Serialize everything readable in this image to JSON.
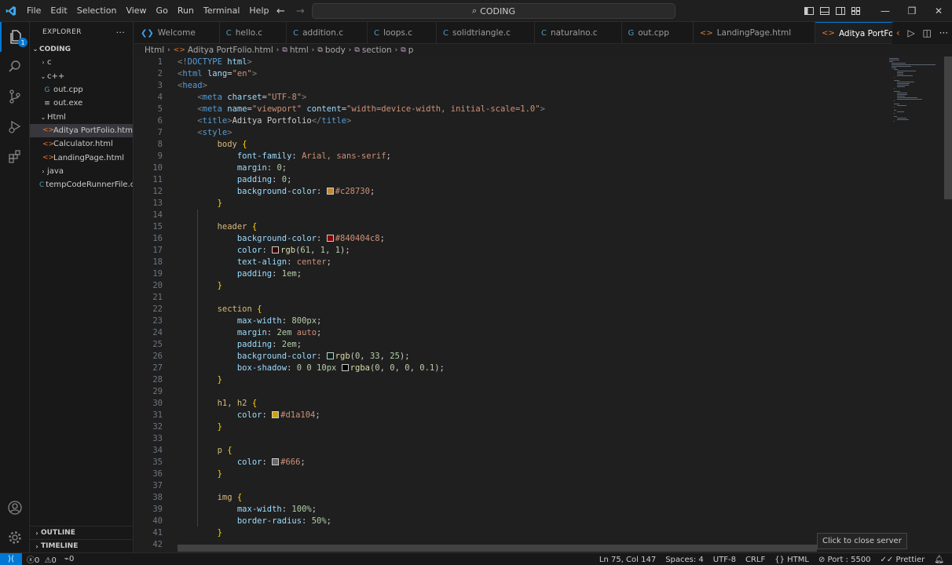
{
  "menu": [
    "File",
    "Edit",
    "Selection",
    "View",
    "Go",
    "Run",
    "Terminal",
    "Help"
  ],
  "command_center": {
    "label": "CODING"
  },
  "sidebar": {
    "title": "EXPLORER",
    "more": "···",
    "root": "CODING",
    "items": [
      {
        "label": "c",
        "kind": "folder",
        "expanded": false,
        "depth": 1
      },
      {
        "label": "c++",
        "kind": "folder",
        "expanded": true,
        "depth": 1
      },
      {
        "label": "out.cpp",
        "kind": "cpp",
        "depth": 2
      },
      {
        "label": "out.exe",
        "kind": "exe",
        "depth": 2
      },
      {
        "label": "Html",
        "kind": "folder",
        "expanded": true,
        "depth": 1
      },
      {
        "label": "Aditya PortFolio.html",
        "kind": "html",
        "depth": 2,
        "selected": true
      },
      {
        "label": "Calculator.html",
        "kind": "html",
        "depth": 2
      },
      {
        "label": "LandingPage.html",
        "kind": "html",
        "depth": 2
      },
      {
        "label": "java",
        "kind": "folder",
        "expanded": false,
        "depth": 1
      },
      {
        "label": "tempCodeRunnerFile.c",
        "kind": "c",
        "depth": 1
      }
    ],
    "outline": "OUTLINE",
    "timeline": "TIMELINE"
  },
  "activity_badge": "1",
  "tabs": [
    {
      "label": "Welcome",
      "icon": "vscode-icon",
      "color": "#3aa7f0"
    },
    {
      "label": "hello.c",
      "icon": "c-file-icon",
      "color": "#519aba"
    },
    {
      "label": "addition.c",
      "icon": "c-file-icon",
      "color": "#519aba"
    },
    {
      "label": "loops.c",
      "icon": "c-file-icon",
      "color": "#519aba"
    },
    {
      "label": "solidtriangle.c",
      "icon": "c-file-icon",
      "color": "#519aba"
    },
    {
      "label": "naturalno.c",
      "icon": "c-file-icon",
      "color": "#519aba"
    },
    {
      "label": "out.cpp",
      "icon": "cpp-file-icon",
      "color": "#519aba"
    },
    {
      "label": "LandingPage.html",
      "icon": "html-file-icon",
      "color": "#e37933"
    },
    {
      "label": "Aditya PortFolio.html",
      "icon": "html-file-icon",
      "color": "#e37933",
      "active": true
    }
  ],
  "breadcrumb": [
    "Html",
    "Aditya PortFolio.html",
    "html",
    "body",
    "section",
    "p"
  ],
  "editor": {
    "line_numbers": [
      "1",
      "2",
      "3",
      "4",
      "5",
      "6",
      "7",
      "8",
      "9",
      "10",
      "11",
      "12",
      "13",
      "14",
      "15",
      "16",
      "17",
      "18",
      "19",
      "20",
      "21",
      "22",
      "23",
      "24",
      "25",
      "26",
      "27",
      "28",
      "29",
      "30",
      "31",
      "32",
      "33",
      "34",
      "35",
      "36",
      "37",
      "38",
      "39",
      "40",
      "41",
      "42"
    ],
    "lines": [
      [
        [
          "tag",
          "<!"
        ],
        [
          "tn",
          "DOCTYPE"
        ],
        [
          "pn",
          " "
        ],
        [
          "an",
          "html"
        ],
        [
          "tag",
          ">"
        ]
      ],
      [
        [
          "tag",
          "<"
        ],
        [
          "tn",
          "html"
        ],
        [
          "pn",
          " "
        ],
        [
          "an",
          "lang"
        ],
        [
          "pn",
          "="
        ],
        [
          "av",
          "\"en\""
        ],
        [
          "tag",
          ">"
        ]
      ],
      [
        [
          "tag",
          "<"
        ],
        [
          "tn",
          "head"
        ],
        [
          "tag",
          ">"
        ]
      ],
      [
        [
          "pn",
          "    "
        ],
        [
          "tag",
          "<"
        ],
        [
          "tn",
          "meta"
        ],
        [
          "pn",
          " "
        ],
        [
          "an",
          "charset"
        ],
        [
          "pn",
          "="
        ],
        [
          "av",
          "\"UTF-8\""
        ],
        [
          "tag",
          ">"
        ]
      ],
      [
        [
          "pn",
          "    "
        ],
        [
          "tag",
          "<"
        ],
        [
          "tn",
          "meta"
        ],
        [
          "pn",
          " "
        ],
        [
          "an",
          "name"
        ],
        [
          "pn",
          "="
        ],
        [
          "av",
          "\"viewport\""
        ],
        [
          "pn",
          " "
        ],
        [
          "an",
          "content"
        ],
        [
          "pn",
          "="
        ],
        [
          "av",
          "\"width=device-width, initial-scale=1.0\""
        ],
        [
          "tag",
          ">"
        ]
      ],
      [
        [
          "pn",
          "    "
        ],
        [
          "tag",
          "<"
        ],
        [
          "tn",
          "title"
        ],
        [
          "tag",
          ">"
        ],
        [
          "pn",
          "Aditya Portfolio"
        ],
        [
          "tag",
          "</"
        ],
        [
          "tn",
          "title"
        ],
        [
          "tag",
          ">"
        ]
      ],
      [
        [
          "pn",
          "    "
        ],
        [
          "tag",
          "<"
        ],
        [
          "tn",
          "style"
        ],
        [
          "tag",
          ">"
        ]
      ],
      [
        [
          "pn",
          "        "
        ],
        [
          "sel",
          "body"
        ],
        [
          "pn",
          " "
        ],
        [
          "br",
          "{"
        ]
      ],
      [
        [
          "pn",
          "            "
        ],
        [
          "pr",
          "font-family"
        ],
        [
          "pn",
          ": "
        ],
        [
          "vl",
          "Arial, sans-serif"
        ],
        [
          "pn",
          ";"
        ]
      ],
      [
        [
          "pn",
          "            "
        ],
        [
          "pr",
          "margin"
        ],
        [
          "pn",
          ": "
        ],
        [
          "nm",
          "0"
        ],
        [
          "pn",
          ";"
        ]
      ],
      [
        [
          "pn",
          "            "
        ],
        [
          "pr",
          "padding"
        ],
        [
          "pn",
          ": "
        ],
        [
          "nm",
          "0"
        ],
        [
          "pn",
          ";"
        ]
      ],
      [
        [
          "pn",
          "            "
        ],
        [
          "pr",
          "background-color"
        ],
        [
          "pn",
          ": "
        ],
        [
          "sw",
          "#c28730"
        ],
        [
          "vl",
          "#c28730"
        ],
        [
          "pn",
          ";"
        ]
      ],
      [
        [
          "pn",
          "        "
        ],
        [
          "br",
          "}"
        ]
      ],
      [],
      [
        [
          "pn",
          "        "
        ],
        [
          "sel",
          "header"
        ],
        [
          "pn",
          " "
        ],
        [
          "br",
          "{"
        ]
      ],
      [
        [
          "pn",
          "            "
        ],
        [
          "pr",
          "background-color"
        ],
        [
          "pn",
          ": "
        ],
        [
          "sw",
          "#840404"
        ],
        [
          "vl",
          "#840404c8"
        ],
        [
          "pn",
          ";"
        ]
      ],
      [
        [
          "pn",
          "            "
        ],
        [
          "pr",
          "color"
        ],
        [
          "pn",
          ": "
        ],
        [
          "sw",
          "#3d0101"
        ],
        [
          "fn",
          "rgb"
        ],
        [
          "pn",
          "("
        ],
        [
          "nm",
          "61"
        ],
        [
          "pn",
          ", "
        ],
        [
          "nm",
          "1"
        ],
        [
          "pn",
          ", "
        ],
        [
          "nm",
          "1"
        ],
        [
          "pn",
          ");"
        ]
      ],
      [
        [
          "pn",
          "            "
        ],
        [
          "pr",
          "text-align"
        ],
        [
          "pn",
          ": "
        ],
        [
          "vl",
          "center"
        ],
        [
          "pn",
          ";"
        ]
      ],
      [
        [
          "pn",
          "            "
        ],
        [
          "pr",
          "padding"
        ],
        [
          "pn",
          ": "
        ],
        [
          "nm",
          "1em"
        ],
        [
          "pn",
          ";"
        ]
      ],
      [
        [
          "pn",
          "        "
        ],
        [
          "br",
          "}"
        ]
      ],
      [],
      [
        [
          "pn",
          "        "
        ],
        [
          "sel",
          "section"
        ],
        [
          "pn",
          " "
        ],
        [
          "br",
          "{"
        ]
      ],
      [
        [
          "pn",
          "            "
        ],
        [
          "pr",
          "max-width"
        ],
        [
          "pn",
          ": "
        ],
        [
          "nm",
          "800px"
        ],
        [
          "pn",
          ";"
        ]
      ],
      [
        [
          "pn",
          "            "
        ],
        [
          "pr",
          "margin"
        ],
        [
          "pn",
          ": "
        ],
        [
          "nm",
          "2em"
        ],
        [
          "pn",
          " "
        ],
        [
          "vl",
          "auto"
        ],
        [
          "pn",
          ";"
        ]
      ],
      [
        [
          "pn",
          "            "
        ],
        [
          "pr",
          "padding"
        ],
        [
          "pn",
          ": "
        ],
        [
          "nm",
          "2em"
        ],
        [
          "pn",
          ";"
        ]
      ],
      [
        [
          "pn",
          "            "
        ],
        [
          "pr",
          "background-color"
        ],
        [
          "pn",
          ": "
        ],
        [
          "sw",
          "#002119"
        ],
        [
          "fn",
          "rgb"
        ],
        [
          "pn",
          "("
        ],
        [
          "nm",
          "0"
        ],
        [
          "pn",
          ", "
        ],
        [
          "nm",
          "33"
        ],
        [
          "pn",
          ", "
        ],
        [
          "nm",
          "25"
        ],
        [
          "pn",
          ");"
        ]
      ],
      [
        [
          "pn",
          "            "
        ],
        [
          "pr",
          "box-shadow"
        ],
        [
          "pn",
          ": "
        ],
        [
          "nm",
          "0"
        ],
        [
          "pn",
          " "
        ],
        [
          "nm",
          "0"
        ],
        [
          "pn",
          " "
        ],
        [
          "nm",
          "10px"
        ],
        [
          "pn",
          " "
        ],
        [
          "sw",
          "#000000"
        ],
        [
          "fn",
          "rgba"
        ],
        [
          "pn",
          "("
        ],
        [
          "nm",
          "0"
        ],
        [
          "pn",
          ", "
        ],
        [
          "nm",
          "0"
        ],
        [
          "pn",
          ", "
        ],
        [
          "nm",
          "0"
        ],
        [
          "pn",
          ", "
        ],
        [
          "nm",
          "0.1"
        ],
        [
          "pn",
          ");"
        ]
      ],
      [
        [
          "pn",
          "        "
        ],
        [
          "br",
          "}"
        ]
      ],
      [],
      [
        [
          "pn",
          "        "
        ],
        [
          "sel",
          "h1, h2"
        ],
        [
          "pn",
          " "
        ],
        [
          "br",
          "{"
        ]
      ],
      [
        [
          "pn",
          "            "
        ],
        [
          "pr",
          "color"
        ],
        [
          "pn",
          ": "
        ],
        [
          "sw",
          "#d1a104"
        ],
        [
          "vl",
          "#d1a104"
        ],
        [
          "pn",
          ";"
        ]
      ],
      [
        [
          "pn",
          "        "
        ],
        [
          "br",
          "}"
        ]
      ],
      [],
      [
        [
          "pn",
          "        "
        ],
        [
          "sel",
          "p"
        ],
        [
          "pn",
          " "
        ],
        [
          "br",
          "{"
        ]
      ],
      [
        [
          "pn",
          "            "
        ],
        [
          "pr",
          "color"
        ],
        [
          "pn",
          ": "
        ],
        [
          "sw",
          "#666666"
        ],
        [
          "vl",
          "#666"
        ],
        [
          "pn",
          ";"
        ]
      ],
      [
        [
          "pn",
          "        "
        ],
        [
          "br",
          "}"
        ]
      ],
      [],
      [
        [
          "pn",
          "        "
        ],
        [
          "sel",
          "img"
        ],
        [
          "pn",
          " "
        ],
        [
          "br",
          "{"
        ]
      ],
      [
        [
          "pn",
          "            "
        ],
        [
          "pr",
          "max-width"
        ],
        [
          "pn",
          ": "
        ],
        [
          "nm",
          "100%"
        ],
        [
          "pn",
          ";"
        ]
      ],
      [
        [
          "pn",
          "            "
        ],
        [
          "pr",
          "border-radius"
        ],
        [
          "pn",
          ": "
        ],
        [
          "nm",
          "50%"
        ],
        [
          "pn",
          ";"
        ]
      ],
      [
        [
          "pn",
          "        "
        ],
        [
          "br",
          "}"
        ]
      ],
      []
    ]
  },
  "tooltip": "Click to close server",
  "status": {
    "errors": "0",
    "warnings": "0",
    "ports": "0",
    "position": "Ln 75, Col 147",
    "spaces": "Spaces: 4",
    "encoding": "UTF-8",
    "eol": "CRLF",
    "language": "HTML",
    "port": "Port : 5500",
    "prettier": "Prettier"
  },
  "colors": {
    "accent": "#0078d4",
    "html_icon": "#e37933",
    "c_icon": "#519aba"
  }
}
